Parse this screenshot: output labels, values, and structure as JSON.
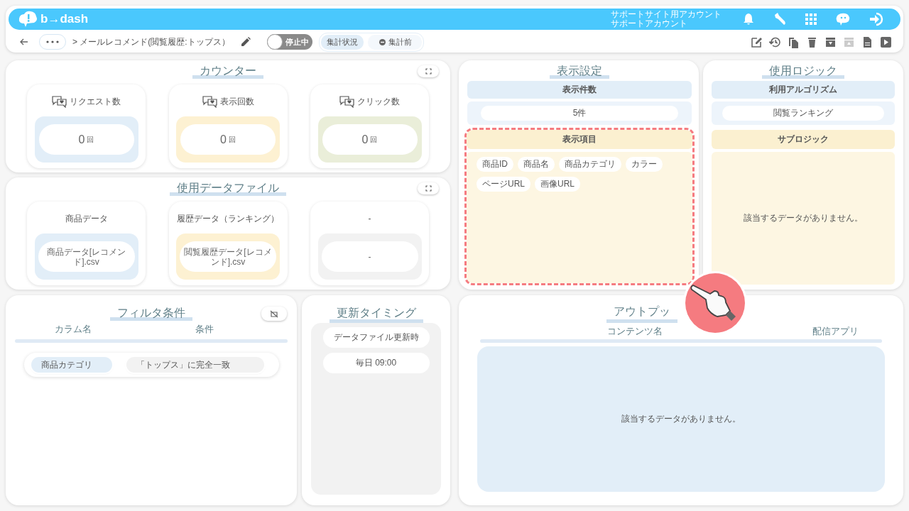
{
  "header": {
    "logo": "b→dash",
    "account_lines": [
      "サポートサイト用アカウント",
      "サポートアカウント"
    ]
  },
  "toolbar": {
    "breadcrumb": "> メールレコメンド(閲覧履歴:トップス）",
    "toggle": {
      "label": "停止中",
      "on": false
    },
    "status_label": "集計状況",
    "status_value": "集計前",
    "actions": [
      {
        "kind": "edit",
        "disabled": false
      },
      {
        "kind": "history",
        "disabled": false
      },
      {
        "kind": "copy",
        "disabled": false
      },
      {
        "kind": "delete",
        "disabled": false
      },
      {
        "kind": "download",
        "disabled": false
      },
      {
        "kind": "upload",
        "disabled": true
      },
      {
        "kind": "document",
        "disabled": false
      },
      {
        "kind": "play",
        "disabled": false
      }
    ]
  },
  "counter": {
    "title": "カウンター",
    "cards": [
      {
        "label": "リクエスト数",
        "value": "0",
        "unit": "回",
        "color": "#e2eef8"
      },
      {
        "label": "表示回数",
        "value": "0",
        "unit": "回",
        "color": "#fdf1d2"
      },
      {
        "label": "クリック数",
        "value": "0",
        "unit": "回",
        "color": "#eaeed9"
      }
    ]
  },
  "data_files": {
    "title": "使用データファイル",
    "cards": [
      {
        "label": "商品データ",
        "file": "商品データ[レコメンド].csv",
        "color": "#e2eef8"
      },
      {
        "label": "履歴データ（ランキング）",
        "file": "閲覧履歴データ[レコメンド].csv",
        "color": "#fdf1d2"
      },
      {
        "label": "-",
        "file": "-",
        "color": "#f2f2f2"
      }
    ]
  },
  "filter": {
    "title": "フィルタ条件",
    "columns": [
      "カラム名",
      "条件"
    ],
    "rows": [
      {
        "column": "商品カテゴリ",
        "condition": "「トップス」に完全一致"
      }
    ]
  },
  "timing": {
    "title": "更新タイミング",
    "items": [
      "データファイル更新時",
      "毎日 09:00"
    ]
  },
  "display": {
    "title": "表示設定",
    "count_label": "表示件数",
    "count": "5件",
    "items_label": "表示項目",
    "highlighted": true,
    "items": [
      "商品ID",
      "商品名",
      "商品カテゴリ",
      "カラー",
      "ページURL",
      "画像URL"
    ]
  },
  "logic": {
    "title": "使用ロジック",
    "algorithm_label": "利用アルゴリズム",
    "algorithm": "閲覧ランキング",
    "sub_label": "サブロジック",
    "sub_empty": "該当するデータがありません。"
  },
  "output": {
    "title": "アウトプッ",
    "columns": [
      "コンテンツ名",
      "配信アプリ"
    ],
    "empty": "該当するデータがありません。"
  }
}
